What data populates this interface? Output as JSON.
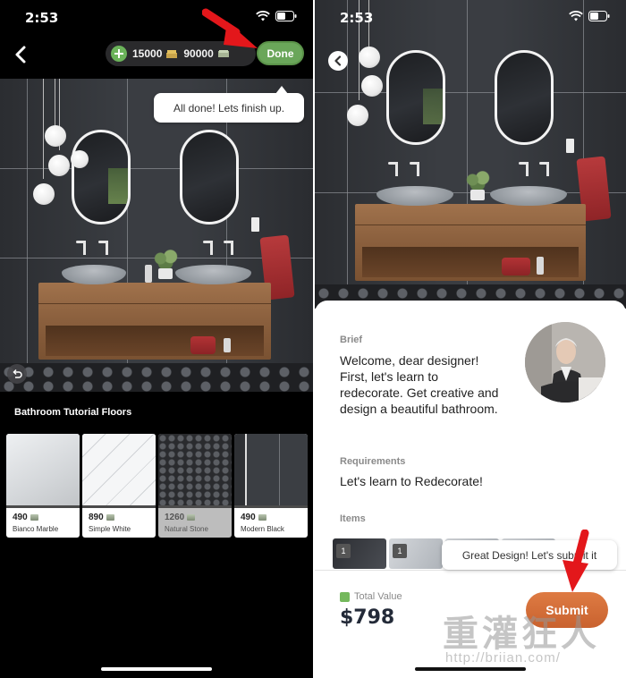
{
  "left_screen": {
    "status": {
      "time": "2:53"
    },
    "header": {
      "coins": "15000",
      "cash": "90000",
      "done_label": "Done"
    },
    "tooltip": "All done! Lets finish up.",
    "section_title": "Bathroom Tutorial Floors",
    "floors": [
      {
        "price": "490",
        "name": "Bianco Marble",
        "selected": false
      },
      {
        "price": "890",
        "name": "Simple White",
        "selected": false
      },
      {
        "price": "1260",
        "name": "Natural Stone",
        "selected": true
      },
      {
        "price": "490",
        "name": "Modern Black",
        "selected": false
      }
    ]
  },
  "right_screen": {
    "status": {
      "time": "2:53"
    },
    "brief": {
      "label": "Brief",
      "text": "Welcome, dear designer! First, let's learn to redecorate. Get creative and design a beautiful bathroom."
    },
    "requirements": {
      "label": "Requirements",
      "text": "Let's learn to Redecorate!"
    },
    "items": {
      "label": "Items",
      "badges": [
        "1",
        "1"
      ]
    },
    "tooltip": "Great Design! Let's submit it",
    "total": {
      "label": "Total Value",
      "value": "$798"
    },
    "submit_label": "Submit"
  },
  "watermark": {
    "title": "重灌狂人",
    "url": "http://briian.com/"
  },
  "colors": {
    "done_green": "#6aa65a",
    "submit_orange": "#d36c38",
    "arrow_red": "#e3171b",
    "tooltip_bg": "#ffffff"
  },
  "icons": [
    "back-chevron-icon",
    "plus-circle-icon",
    "coin-stack-icon",
    "cash-icon",
    "wifi-icon",
    "battery-icon",
    "undo-icon",
    "cash-small-icon",
    "total-value-icon",
    "red-arrow-icon"
  ]
}
